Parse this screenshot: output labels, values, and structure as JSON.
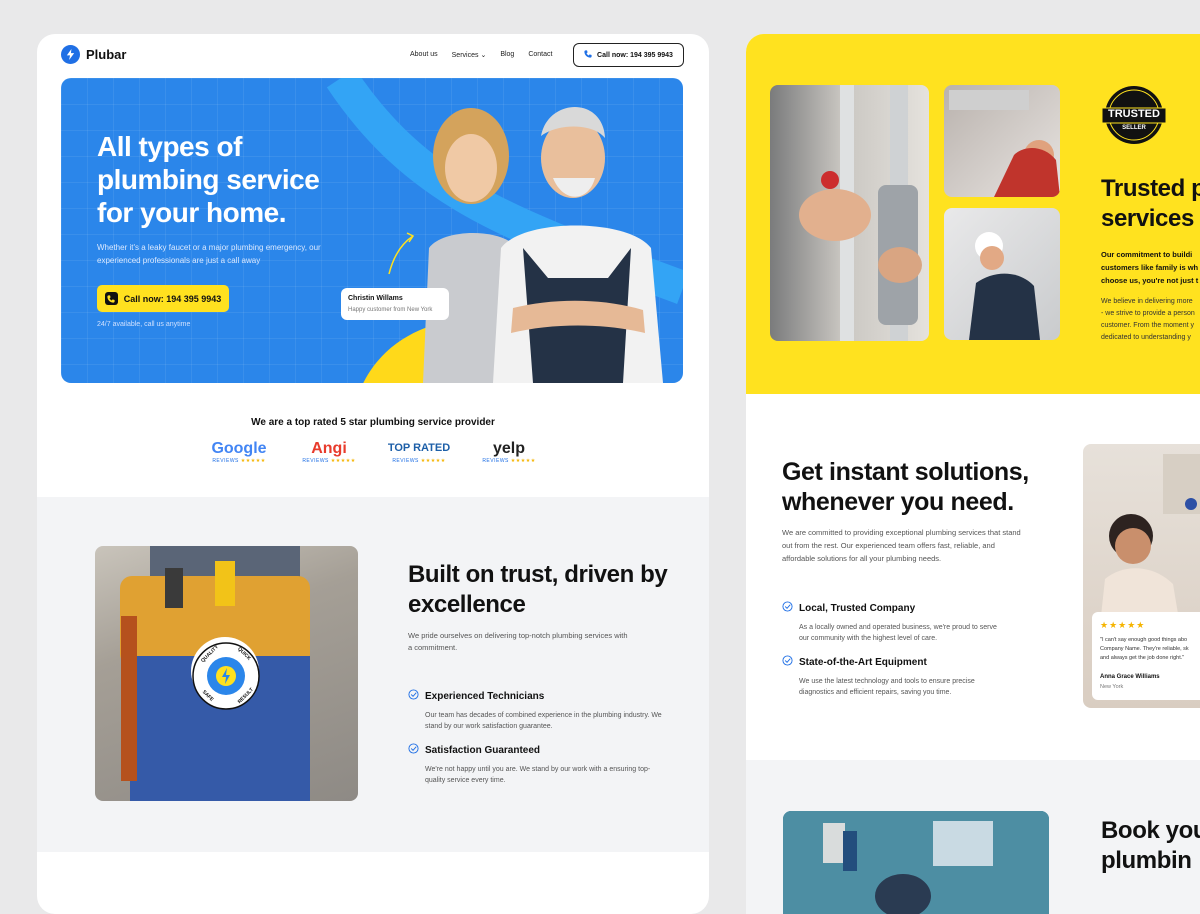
{
  "nav": {
    "logo": "Plubar",
    "links": [
      "About us",
      "Services",
      "Blog",
      "Contact"
    ],
    "call_button": "Call now: 194 395 9943"
  },
  "hero": {
    "title": "All types of plumbing service for your home.",
    "subtitle": "Whether it's a leaky faucet or a major plumbing emergency, our experienced professionals are just a call away",
    "cta": "Call now: 194 395 9943",
    "note": "24/7 available, call us anytime",
    "testimonial_name": "Christin Willams",
    "testimonial_role": "Happy customer from New York"
  },
  "rated": {
    "title": "We are a top rated 5 star plumbing service provider",
    "reviews": [
      {
        "brand": "Google",
        "sub": "REVIEWS",
        "stars": "★★★★★"
      },
      {
        "brand": "Angi",
        "sub": "REVIEWS",
        "stars": "★★★★★"
      },
      {
        "brand": "TOP RATED",
        "sub": "REVIEWS",
        "stars": "★★★★★"
      },
      {
        "brand": "yelp",
        "sub": "REVIEWS",
        "stars": "★★★★★"
      }
    ]
  },
  "trust": {
    "title": "Built on trust, driven by excellence",
    "subtitle": "We pride ourselves on delivering top-notch plumbing services with a commitment.",
    "badge_words": [
      "QUALITY",
      "QUICK",
      "RESULT",
      "SAFE"
    ],
    "features": [
      {
        "title": "Experienced Technicians",
        "desc": "Our team has decades of combined experience in the plumbing industry. We stand by our work satisfaction guarantee."
      },
      {
        "title": "Satisfaction Guaranteed",
        "desc": "We're not happy until you are. We stand by our work with a ensuring top-quality service every time."
      }
    ]
  },
  "yellow_section": {
    "badge_top": "TRUSTED",
    "badge_bottom": "SELLER",
    "title_line1": "Trusted p",
    "title_line2": "services t",
    "bold_lines": [
      "Our commitment to buildi",
      "customers like family is wh",
      "choose us, you're not just t"
    ],
    "body_lines": [
      "We believe in delivering more",
      "- we strive to provide a person",
      "customer. From the moment y",
      "dedicated to understanding y"
    ]
  },
  "instant": {
    "title": "Get instant solutions, whenever you need.",
    "subtitle": "We are committed to providing exceptional plumbing services that stand out from the rest. Our experienced team offers fast, reliable, and affordable solutions for all your plumbing needs.",
    "features": [
      {
        "title": "Local, Trusted Company",
        "desc": "As a locally owned and operated business, we're proud to serve our community with the highest level of care."
      },
      {
        "title": "State-of-the-Art Equipment",
        "desc": "We use the latest technology and tools to ensure precise diagnostics and efficient repairs, saving you time."
      }
    ]
  },
  "review_card": {
    "stars": "★★★★★",
    "lines": [
      "\"I can't say enough good things abo",
      "Company Name. They're reliable, sk",
      "and always get the job done right.\""
    ],
    "name": "Anna Grace Williams",
    "city": "New York"
  },
  "book": {
    "title_line1": "Book you",
    "title_line2": "plumbin"
  },
  "colors": {
    "brand_blue": "#2b86ea",
    "accent_yellow": "#ffe21f",
    "light_gray": "#f3f4f6"
  }
}
